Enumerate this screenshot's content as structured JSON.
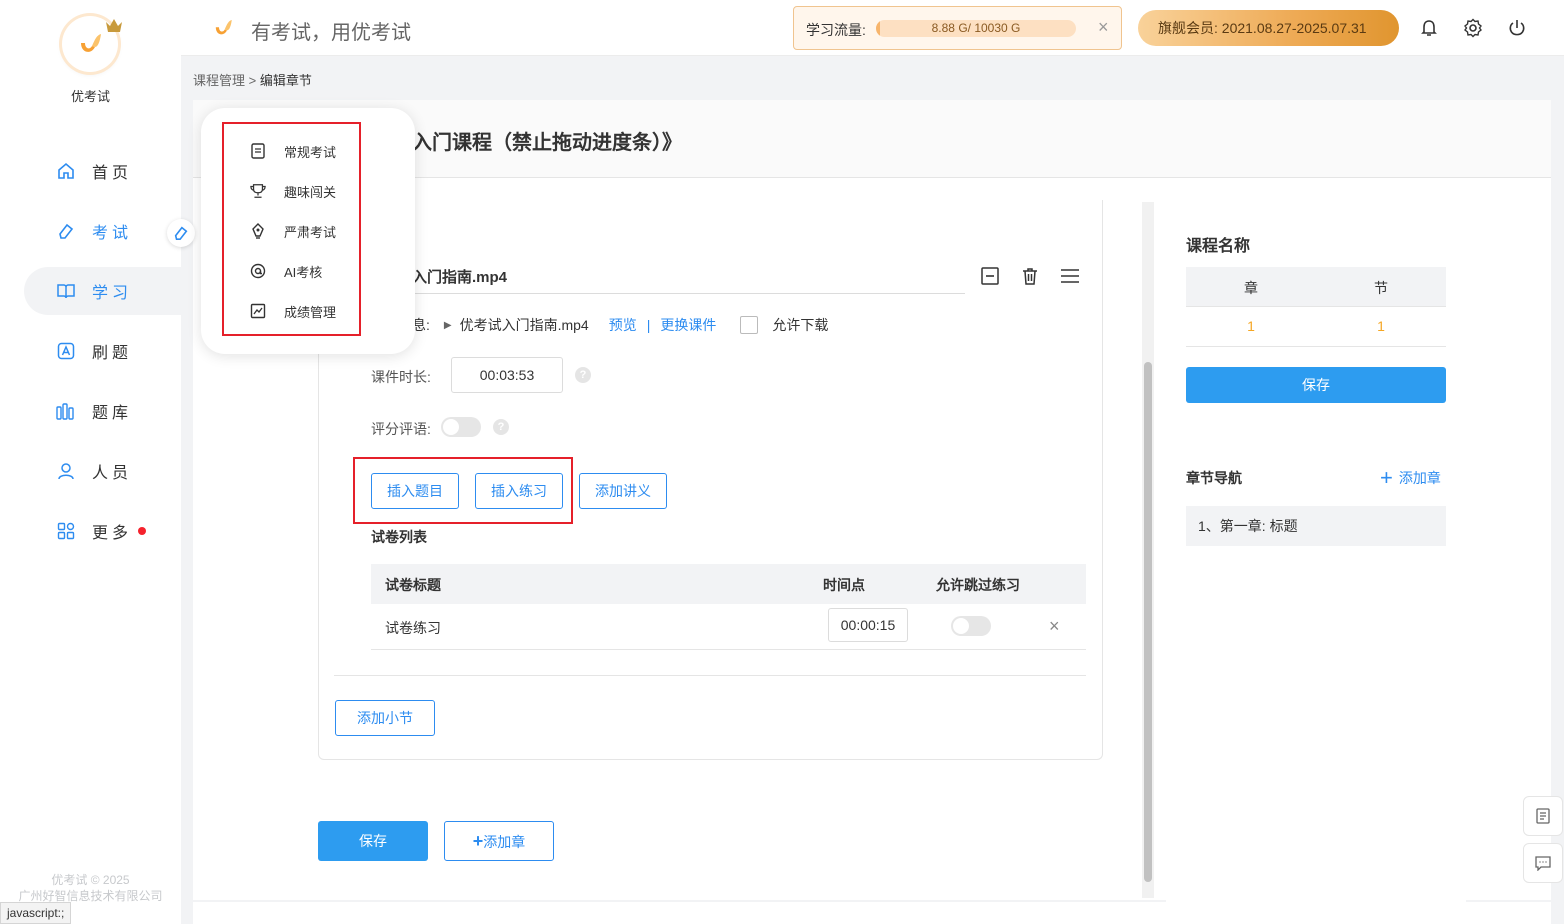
{
  "app": {
    "name": "优考试",
    "slogan": "有考试，用优考试",
    "footer_line1": "优考试 © 2025",
    "footer_line2": "广州好智信息技术有限公司",
    "status_url": "javascript:;"
  },
  "colors": {
    "accent": "#2d8cf0",
    "orange": "#f5a623",
    "red": "#e5202a"
  },
  "sidebar": {
    "items": [
      {
        "label": "首页",
        "icon": "home-icon"
      },
      {
        "label": "考试",
        "icon": "eraser-icon"
      },
      {
        "label": "学习",
        "icon": "book-icon"
      },
      {
        "label": "刷题",
        "icon": "letter-a-icon"
      },
      {
        "label": "题库",
        "icon": "library-icon"
      },
      {
        "label": "人员",
        "icon": "user-icon"
      },
      {
        "label": "更多",
        "icon": "grid-icon"
      }
    ]
  },
  "header": {
    "traffic_label": "学习流量:",
    "traffic_value": "8.88 G/ 10030 G",
    "traffic_ratio": 0.0009,
    "vip_text": "旗舰会员:  2021.08.27-2025.07.31"
  },
  "breadcrumb": {
    "parent": "课程管理",
    "sep": ">",
    "current": "编辑章节"
  },
  "course": {
    "title": "入门课程（禁止拖动进度条）》"
  },
  "exam_menu": {
    "items": [
      {
        "label": "常规考试",
        "icon": "document-icon"
      },
      {
        "label": "趣味闯关",
        "icon": "trophy-icon"
      },
      {
        "label": "严肃考试",
        "icon": "pen-nib-icon"
      },
      {
        "label": "AI考核",
        "icon": "ai-icon"
      },
      {
        "label": "成绩管理",
        "icon": "chart-icon"
      }
    ]
  },
  "section": {
    "file_name": "入门指南.mp4",
    "info_label": "息:",
    "file_link_name": "优考试入门指南.mp4",
    "preview": "预览",
    "link_sep": "|",
    "replace": "更换课件",
    "allow_download": "允许下载",
    "duration_label": "课件时长:",
    "duration": "00:03:53",
    "rating_label": "评分评语:",
    "help_mark": "?",
    "btn_insert_question": "插入题目",
    "btn_insert_exercise": "插入练习",
    "btn_add_notes": "添加讲义",
    "paper_list_label": "试卷列表",
    "table_headers": {
      "title": "试卷标题",
      "time": "时间点",
      "skip": "允许跳过练习"
    },
    "rows": [
      {
        "title": "试卷练习",
        "time": "00:00:15"
      }
    ],
    "btn_add_subsection": "添加小节"
  },
  "footer_actions": {
    "save": "保存",
    "add_chapter": "添加章",
    "plus": "+"
  },
  "right_panel": {
    "course_name_title": "课程名称",
    "col_chapter": "章",
    "col_section": "节",
    "chapter_count": "1",
    "section_count": "1",
    "save": "保存",
    "nav_title": "章节导航",
    "add_chapter": "添加章",
    "chapters": [
      "1、第一章:  标题"
    ]
  }
}
